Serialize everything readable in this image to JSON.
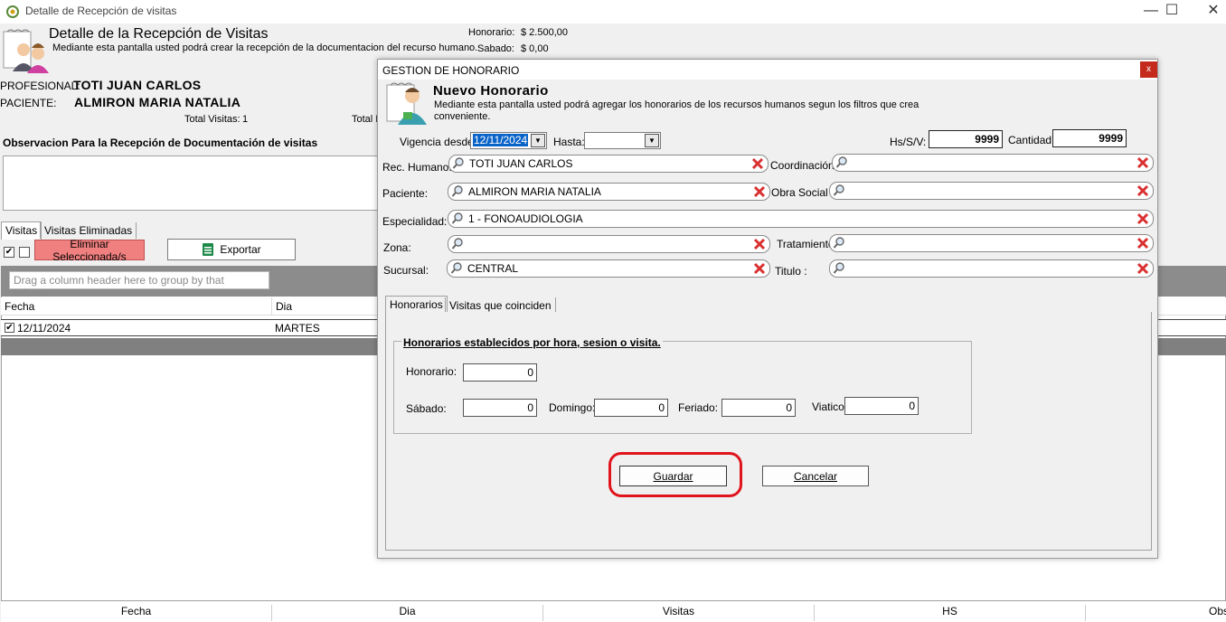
{
  "window": {
    "title": "Detalle de Recepción de visitas",
    "minimize": "—",
    "maximize": "☐",
    "close": "✕"
  },
  "header": {
    "title": "Detalle de la Recepción de Visitas",
    "subtitle": "Mediante esta pantalla usted podrá crear la recepción de la documentacion del recurso humano.",
    "honorario_label": "Honorario:",
    "honorario_value": "$ 2.500,00",
    "sabado_label": "Sabado:",
    "sabado_value": "$ 0,00"
  },
  "info": {
    "profesional_label": "PROFESIONAL:",
    "profesional_value": "TOTI JUAN CARLOS",
    "paciente_label": "PACIENTE:",
    "paciente_value": "ALMIRON MARIA NATALIA",
    "total_visitas_label": "Total Visitas:",
    "total_visitas_value": "1",
    "total_other": "Total I"
  },
  "observacion": {
    "label": "Observacion Para la Recepción de Documentación de visitas",
    "value": ""
  },
  "tabs": [
    {
      "label": "Visitas"
    },
    {
      "label": "Visitas Eliminadas"
    }
  ],
  "toolbar": {
    "delete_label": "Eliminar Seleccionada/s",
    "export_label": "Exportar",
    "delete_color": "#f08080"
  },
  "grid": {
    "group_hint": "Drag a column header here to group by that column.",
    "columns": [
      "Fecha",
      "Dia"
    ],
    "rows": [
      {
        "checked": true,
        "fecha": "12/11/2024",
        "dia": "MARTES"
      }
    ],
    "footer": [
      "Fecha",
      "Dia",
      "Visitas",
      "HS",
      "Obs"
    ]
  },
  "modal": {
    "title": "GESTION DE HONORARIO",
    "close": "x",
    "heading": "Nuevo Honorario",
    "subtitle": "Mediante esta pantalla usted podrá agregar los honorarios de los recursos humanos segun los filtros que crea conveniente.",
    "vigencia_label": "Vigencia desde:",
    "vigencia_value": "12/11/2024",
    "hasta_label": "Hasta:",
    "hasta_value": "",
    "hs_label": "Hs/S/V:",
    "hs_value": "9999",
    "cantidad_label": "Cantidad:",
    "cantidad_value": "9999",
    "fields": {
      "rec_humano": {
        "label": "Rec. Humano:",
        "value": "TOTI JUAN CARLOS"
      },
      "coordinacion": {
        "label": "Coordinación:",
        "value": ""
      },
      "paciente": {
        "label": "Paciente:",
        "value": "ALMIRON MARIA NATALIA"
      },
      "obra_social": {
        "label": "Obra Social :",
        "value": ""
      },
      "especialidad": {
        "label": "Especialidad:",
        "value": "1 - FONOAUDIOLOGIA"
      },
      "zona": {
        "label": "Zona:",
        "value": ""
      },
      "tratamiento": {
        "label": "Tratamiento",
        "value": ""
      },
      "sucursal": {
        "label": "Sucursal:",
        "value": "CENTRAL"
      },
      "titulo": {
        "label": "Titulo :",
        "value": ""
      }
    },
    "tabs": [
      {
        "label": "Honorarios"
      },
      {
        "label": "Visitas que coinciden"
      }
    ],
    "honorarios": {
      "legend": "Honorarios establecidos por hora, sesion o visita.",
      "honorario_label": "Honorario:",
      "honorario_value": "0",
      "sabado_label": "Sábado:",
      "sabado_value": "0",
      "domingo_label": "Domingo:",
      "domingo_value": "0",
      "feriado_label": "Feriado:",
      "feriado_value": "0",
      "viatico_label": "Viatico:",
      "viatico_value": "0"
    },
    "guardar_label": "Guardar",
    "cancelar_label": "Cancelar",
    "highlight_color": "#e0141c"
  }
}
